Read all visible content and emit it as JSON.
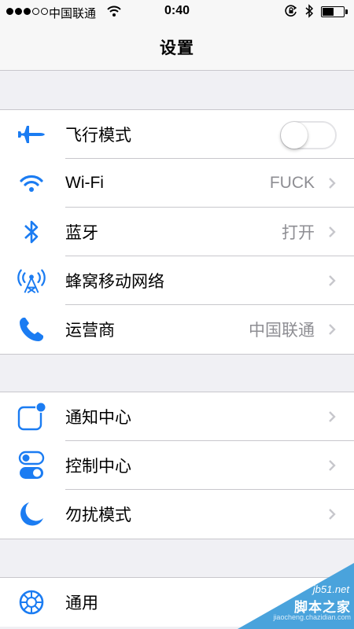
{
  "status_bar": {
    "carrier": "中国联通",
    "time": "0:40",
    "signal_bars_filled": 3,
    "signal_bars_total": 5
  },
  "nav": {
    "title": "设置"
  },
  "colors": {
    "accent": "#1b7cf2",
    "secondary_text": "#8e8e93",
    "separator": "#c8c7cc",
    "background": "#f0f0f4"
  },
  "groups": [
    {
      "items": [
        {
          "icon": "airplane-icon",
          "label": "飞行模式",
          "toggle": "off"
        },
        {
          "icon": "wifi-icon",
          "label": "Wi-Fi",
          "value": "FUCK"
        },
        {
          "icon": "bluetooth-icon",
          "label": "蓝牙",
          "value": "打开"
        },
        {
          "icon": "cellular-antenna-icon",
          "label": "蜂窝移动网络",
          "value": ""
        },
        {
          "icon": "phone-icon",
          "label": "运营商",
          "value": "中国联通"
        }
      ]
    },
    {
      "items": [
        {
          "icon": "notification-center-icon",
          "label": "通知中心"
        },
        {
          "icon": "control-center-icon",
          "label": "控制中心"
        },
        {
          "icon": "moon-icon",
          "label": "勿扰模式"
        }
      ]
    },
    {
      "items": [
        {
          "icon": "gear-icon",
          "label": "通用"
        }
      ]
    }
  ],
  "watermark": {
    "site": "jb51.net",
    "name": "脚本之家",
    "text": "jiaocheng.chazidian.com"
  }
}
